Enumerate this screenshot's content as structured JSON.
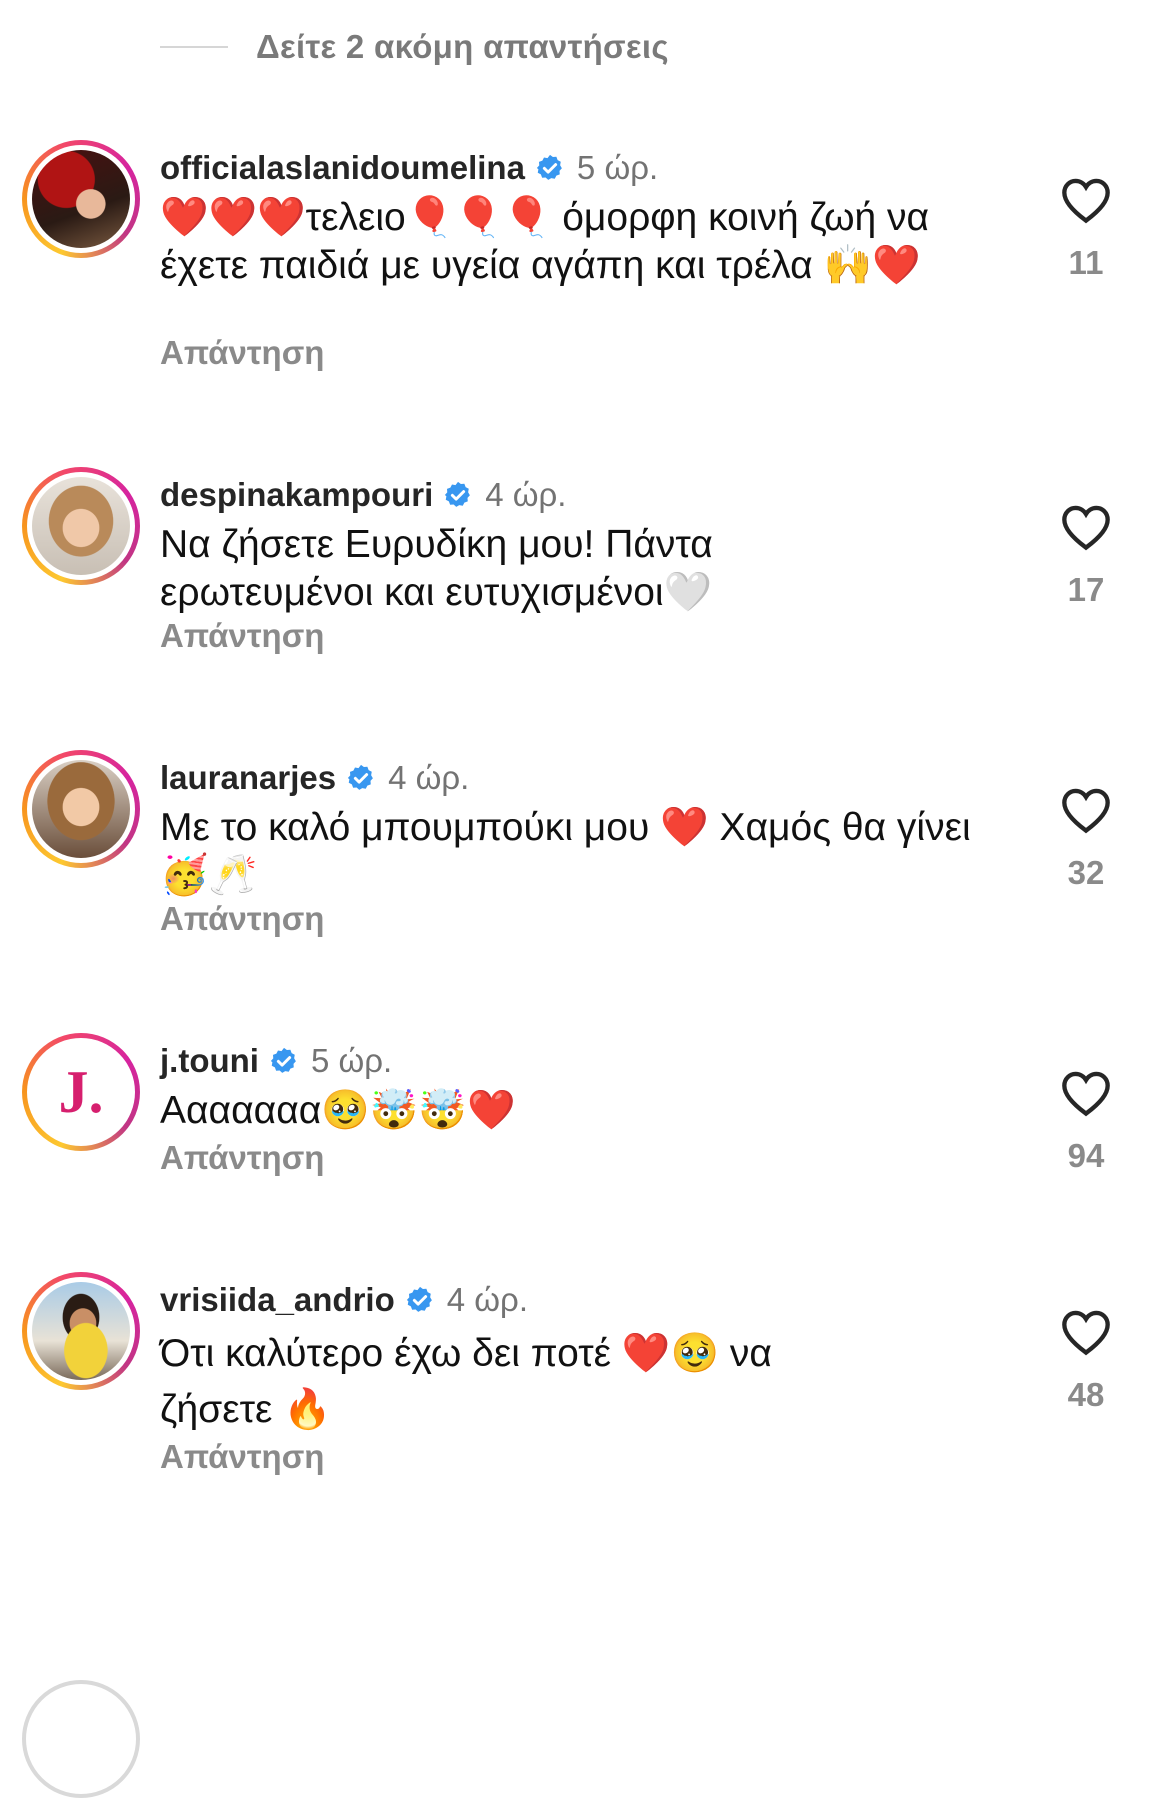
{
  "header": {
    "more_replies": "Δείτε 2 ακόμη απαντήσεις"
  },
  "reply_label": "Απάντηση",
  "comments": [
    {
      "username": "officialaslanidoumelina",
      "time": "5 ώρ.",
      "text": "❤️❤️❤️τελειο🎈🎈🎈 όμορφη κοινή ζωή να έχετε παιδιά με υγεία αγάπη και τρέλα 🙌❤️",
      "likes": "11",
      "avatar": "avatar-photo"
    },
    {
      "username": "despinakampouri",
      "time": "4 ώρ.",
      "text": "Να ζήσετε Ευρυδίκη μου! Πάντα ερωτευμένοι και ευτυχισμένοι🤍",
      "likes": "17",
      "avatar": "avatar-photo"
    },
    {
      "username": "lauranarjes",
      "time": "4 ώρ.",
      "text": "Με το καλό μπουμπούκι μου ❤️ Χαμός θα γίνει 🥳🥂",
      "likes": "32",
      "avatar": "avatar-photo"
    },
    {
      "username": "j.touni",
      "time": "5 ώρ.",
      "text": "Ααααααα🥹🤯🤯❤️",
      "likes": "94",
      "avatar": "J."
    },
    {
      "username": "vrisiida_andrio",
      "time": "4 ώρ.",
      "text": "Ότι καλύτερο έχω δει ποτέ ❤️🥹 να ζήσετε 🔥",
      "likes": "48",
      "avatar": "avatar-photo"
    }
  ],
  "colors": {
    "verified": "#3897f0",
    "secondary_text": "#737373",
    "story_ring": "#d6249f"
  },
  "icons": {
    "verified": "verified-badge-icon",
    "like": "heart-outline-icon"
  }
}
